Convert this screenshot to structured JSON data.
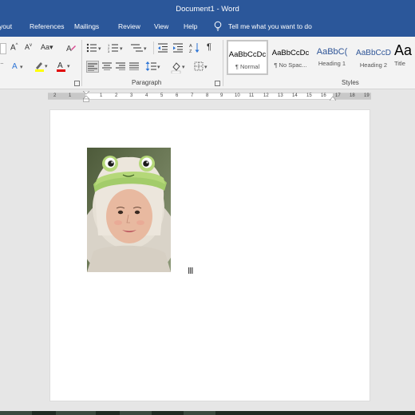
{
  "window": {
    "title": "Document1  -  Word"
  },
  "tabs": [
    {
      "label": "yout"
    },
    {
      "label": "References"
    },
    {
      "label": "Mailings"
    },
    {
      "label": "Review"
    },
    {
      "label": "View"
    },
    {
      "label": "Help"
    }
  ],
  "tellme": {
    "placeholder": "Tell me what you want to do"
  },
  "ribbon": {
    "paragraph_label": "Paragraph",
    "styles_label": "Styles",
    "styles": [
      {
        "sample": "AaBbCcDc",
        "name": "¶ Normal",
        "selected": true
      },
      {
        "sample": "AaBbCcDc",
        "name": "¶ No Spac...",
        "selected": false
      },
      {
        "sample": "AaBbC(",
        "name": "Heading 1",
        "selected": false
      },
      {
        "sample": "AaBbCcD",
        "name": "Heading 2",
        "selected": false
      },
      {
        "sample": "Aa",
        "name": "Title",
        "selected": false
      }
    ]
  },
  "colors": {
    "brand_blue": "#2b579a",
    "font_color_red": "#e00000",
    "highlight_yellow": "#ffff00"
  },
  "ruler": {
    "numbers": [
      "2",
      "1",
      "1",
      "2",
      "3",
      "4",
      "5",
      "6",
      "7",
      "8",
      "9",
      "10",
      "11",
      "12",
      "13",
      "14",
      "15",
      "16",
      "17",
      "18",
      "19"
    ]
  }
}
